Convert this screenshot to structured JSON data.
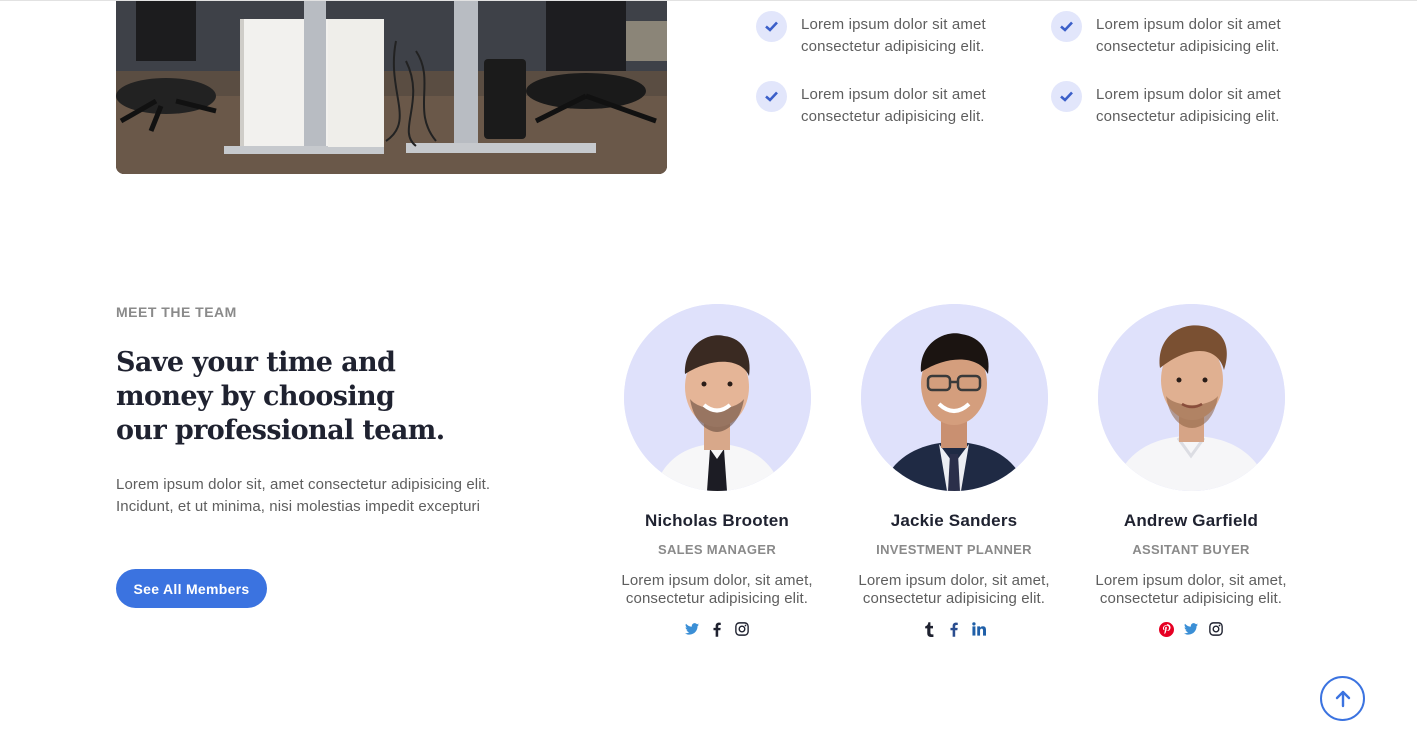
{
  "features": [
    {
      "icon": "check-icon",
      "text": "Lorem ipsum dolor sit amet consectetur adipisicing elit."
    },
    {
      "icon": "check-icon",
      "text": "Lorem ipsum dolor sit amet consectetur adipisicing elit."
    },
    {
      "icon": "check-icon",
      "text": "Lorem ipsum dolor sit amet consectetur adipisicing elit."
    },
    {
      "icon": "check-icon",
      "text": "Lorem ipsum dolor sit amet consectetur adipisicing elit."
    }
  ],
  "team": {
    "eyebrow": "MEET THE TEAM",
    "headline": "Save your time and money by choosing our professional team.",
    "intro": "Lorem ipsum dolor sit, amet consectetur adipisicing elit. Incidunt, et ut minima, nisi molestias impedit excepturi",
    "cta_label": "See All Members",
    "members": [
      {
        "name": "Nicholas Brooten",
        "role": "SALES MANAGER",
        "bio": "Lorem ipsum dolor, sit amet, consectetur adipisicing elit.",
        "socials": [
          "twitter-icon",
          "facebook-icon",
          "instagram-icon"
        ]
      },
      {
        "name": "Jackie Sanders",
        "role": "INVESTMENT PLANNER",
        "bio": "Lorem ipsum dolor, sit amet, consectetur adipisicing elit.",
        "socials": [
          "tumblr-icon",
          "facebook-icon",
          "linkedin-icon"
        ]
      },
      {
        "name": "Andrew Garfield",
        "role": "ASSITANT BUYER",
        "bio": "Lorem ipsum dolor, sit amet, consectetur adipisicing elit.",
        "socials": [
          "pinterest-icon",
          "twitter-icon",
          "instagram-icon"
        ]
      }
    ]
  },
  "colors": {
    "accent": "#3b73e0",
    "avatar_bg": "#dfe1fb",
    "check_bg": "#e2e6fb",
    "heading": "#1f2230",
    "body_text": "#5e5e5e",
    "muted": "#8a8a8a",
    "twitter": "#1da1f2",
    "facebook": "#1f2230",
    "linkedin": "#0a66c2",
    "pinterest": "#e60023",
    "tumblr": "#35465c"
  },
  "back_to_top": {
    "icon": "arrow-up-icon"
  }
}
